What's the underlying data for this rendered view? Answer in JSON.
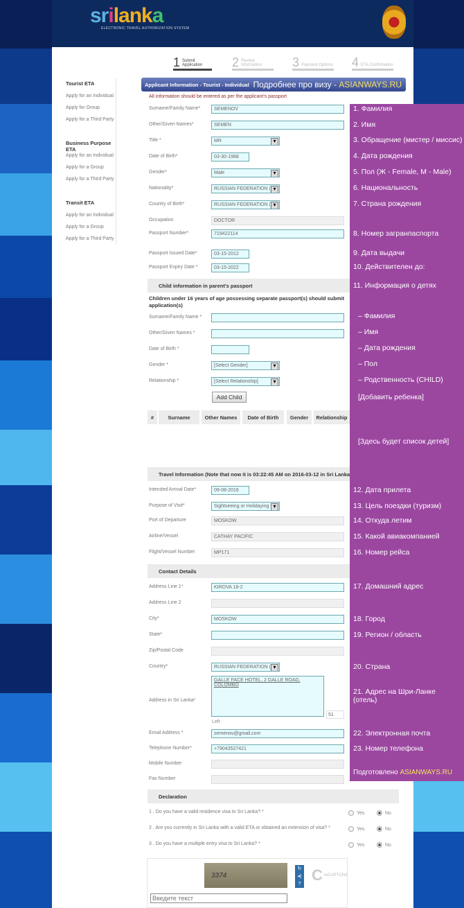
{
  "header": {
    "logo_text": [
      "sri",
      "",
      "lank",
      "a",
      ""
    ],
    "logo_letters": [
      "sr",
      "i",
      "lank",
      "a"
    ],
    "tagline": "ELECTRONIC TRAVEL AUTHORIZATION SYSTEM",
    "emblem": "sri-lanka-emblem"
  },
  "steps": [
    {
      "num": "1",
      "label": "Submit Application",
      "active": true
    },
    {
      "num": "2",
      "label": "Review Information"
    },
    {
      "num": "3",
      "label": "Payment Options"
    },
    {
      "num": "4",
      "label": "ETA Confirmation"
    }
  ],
  "sidebar": [
    {
      "heading": "Tourist ETA",
      "items": [
        "Apply for an Individual",
        "Apply for Group",
        "Apply for a Third Party"
      ]
    },
    {
      "heading": "Business Purpose ETA",
      "items": [
        "Apply for an Individual",
        "Apply for a Group",
        "Apply for a Third Party"
      ]
    },
    {
      "heading": "Transit ETA",
      "items": [
        "Apply for an Individual",
        "Apply for a Group",
        "Apply for a Third Party"
      ]
    }
  ],
  "form_bar": {
    "title": "Applicant Information - Tourist - Individual",
    "promo": "Подробнее про визу - ",
    "promo_brand": "ASIANWAYS.RU"
  },
  "note": "All information should be entered as per the applicant's passport",
  "applicant_fields": [
    {
      "label": "Surname/Family Name*",
      "value": "SEMENOV",
      "type": "text"
    },
    {
      "label": "Other/Given Names*",
      "value": "SEMEN",
      "type": "text"
    },
    {
      "label": "Title *",
      "value": "MR",
      "type": "select"
    },
    {
      "label": "Date of Birth*",
      "value": "03-30-1988",
      "type": "date"
    },
    {
      "label": "Gender*",
      "value": "Male",
      "type": "select"
    },
    {
      "label": "Nationality*",
      "value": "RUSSIAN FEDERATION (R",
      "type": "select"
    },
    {
      "label": "Country of Birth*",
      "value": "RUSSIAN FEDERATION (R",
      "type": "select"
    },
    {
      "label": "Occupation",
      "value": "DOCTOR",
      "type": "gray"
    },
    {
      "label": "Passport Number*",
      "value": "719422114",
      "type": "text"
    },
    {
      "label": "Passport Issued Date*",
      "value": "03-15-2012",
      "type": "date"
    },
    {
      "label": "Passport Expiry Date *",
      "value": "03-15-2022",
      "type": "date"
    }
  ],
  "child_section": {
    "title": "Child information in parent's passport",
    "note": "Children under 16 years of age possessing separate passport(s) should submit application(s)",
    "fields": [
      {
        "label": "Surname/Family Name *",
        "value": "",
        "type": "text"
      },
      {
        "label": "Other/Given Names *",
        "value": "",
        "type": "text"
      },
      {
        "label": "Date of Birth *",
        "value": "",
        "type": "date"
      },
      {
        "label": "Gender *",
        "value": "[Select Gender]",
        "type": "select"
      },
      {
        "label": "Relationship *",
        "value": "[Select Relationship]",
        "type": "select"
      }
    ],
    "add_button": "Add Child",
    "table_headers": [
      "#",
      "Surname",
      "Other Names",
      "Date of Birth",
      "Gender",
      "Relationship"
    ]
  },
  "travel_section": {
    "title": "Travel Information     (Note that now it is 03:22:45 AM on 2016-03-12 in Sri Lanka)",
    "fields": [
      {
        "label": "Intended Arrival Date*",
        "value": "09-08-2016",
        "type": "date"
      },
      {
        "label": "Purpose of Visit*",
        "value": "Sightseeing or Holidaying",
        "type": "select"
      },
      {
        "label": "Port of Departure",
        "value": "MOSKOW",
        "type": "gray"
      },
      {
        "label": "Airline/Vessel",
        "value": "CATHAY PACIFIC",
        "type": "gray"
      },
      {
        "label": "Flight/Vessel Number",
        "value": "MP171",
        "type": "gray"
      }
    ]
  },
  "contact_section": {
    "title": "Contact Details",
    "fields": [
      {
        "label": "Address Line 1*",
        "value": "KIROVA 18-2",
        "type": "text"
      },
      {
        "label": "Address Line 2",
        "value": "",
        "type": "gray"
      },
      {
        "label": "City*",
        "value": "MOSKOW",
        "type": "text"
      },
      {
        "label": "State*",
        "value": "",
        "type": "text"
      },
      {
        "label": "Zip/Postal Code",
        "value": "",
        "type": "gray"
      },
      {
        "label": "Country*",
        "value": "RUSSIAN FEDERATION (R",
        "type": "select"
      }
    ],
    "address_sl_label": "Address in Sri Lanka*",
    "address_sl_value": "GALLE FACE HOTEL, 2 GALLE ROAD, COLOMBO",
    "char_count": "51",
    "chars_left": "Left",
    "fields2": [
      {
        "label": "Email Address *",
        "value": "semenov@gmail.com",
        "type": "text"
      },
      {
        "label": "Telephone Number*",
        "value": "+79043527421",
        "type": "text"
      },
      {
        "label": "Mobile Number",
        "value": "",
        "type": "gray"
      },
      {
        "label": "Fax Number",
        "value": "",
        "type": "gray"
      }
    ]
  },
  "declaration": {
    "title": "Declaration",
    "yes": "Yes",
    "no": "No",
    "questions": [
      {
        "text": "1 . Do you have a valid residence visa to Sri Lanka? *",
        "answer": "No"
      },
      {
        "text": "2 . Are you currently in Sri Lanka with a valid ETA or obtained an extension of visa? *",
        "answer": "No"
      },
      {
        "text": "3 . Do you have a multiple entry visa to Sri Lanka? *",
        "answer": "No"
      }
    ]
  },
  "captcha": {
    "image_text": "3374",
    "placeholder": "Введите текст",
    "brand": "reCAPTCHA",
    "icons": [
      "refresh-icon",
      "audio-icon",
      "help-icon"
    ]
  },
  "annotations": [
    "1. Фамилия",
    "2. Имя",
    "3. Обращение (мистер / миссис)",
    "4. Дата рождения",
    "5. Пол (Ж - Female, M - Male)",
    "6. Национальность",
    "7. Страна рождения",
    "8. Номер загранпаспорта",
    "9. Дата выдачи",
    "10. Действителен до:",
    "11. Информация о детях",
    "– Фамилия",
    "– Имя",
    "– Дата рождения",
    "– Пол",
    "– Родственность (CHILD)",
    "[Добавить ребенка]",
    "[Здесь будет список детей]",
    "12. Дата прилета",
    "13. Цель поездки (туризм)",
    "14. Откуда летим",
    "15. Какой авиакомпанией",
    "16. Номер рейса",
    "17. Домашний адрес",
    "18. Город",
    "19. Регион / область",
    "20. Страна",
    "21. Адрес на Шри-Ланке\n(отель)",
    "22. Электронная почта",
    "23. Номер телефона"
  ],
  "credit": {
    "text": "Подготовлено ",
    "brand": "ASIANWAYS.RU"
  },
  "colors": {
    "overlay": "#9b47a0",
    "header": "#0d2a5e",
    "brand_highlight": "#f5e060"
  }
}
